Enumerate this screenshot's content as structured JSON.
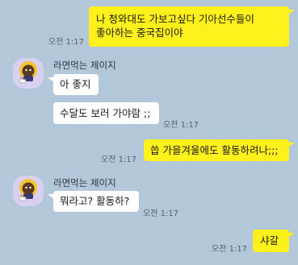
{
  "chat": {
    "messages": [
      {
        "sender": "me",
        "text": "나 청와대도 가보고싶다 기아선수들이 좋아하는 중국집이야",
        "time": "오전 1:17"
      },
      {
        "sender": "other",
        "name": "라면먹는 제이지",
        "text": "아 좋지"
      },
      {
        "sender": "other",
        "text": "수달도 보러 가야람 ;;",
        "time": "오전 1:17"
      },
      {
        "sender": "me",
        "text": "씁 가을겨울에도 활동하려나;;;",
        "time": "오전 1:17"
      },
      {
        "sender": "other",
        "name": "라면먹는 제이지",
        "text": "뭐라고? 활동하?",
        "time": "오전 1:17"
      },
      {
        "sender": "me",
        "text": "샤갈",
        "time": "오전 1:17"
      }
    ]
  },
  "avatar": {
    "icon": "ramen-character-icon",
    "bg_color": "#d9cfee"
  },
  "colors": {
    "background": "#b2c7d9",
    "my_bubble": "#fef01b",
    "other_bubble": "#ffffff"
  }
}
